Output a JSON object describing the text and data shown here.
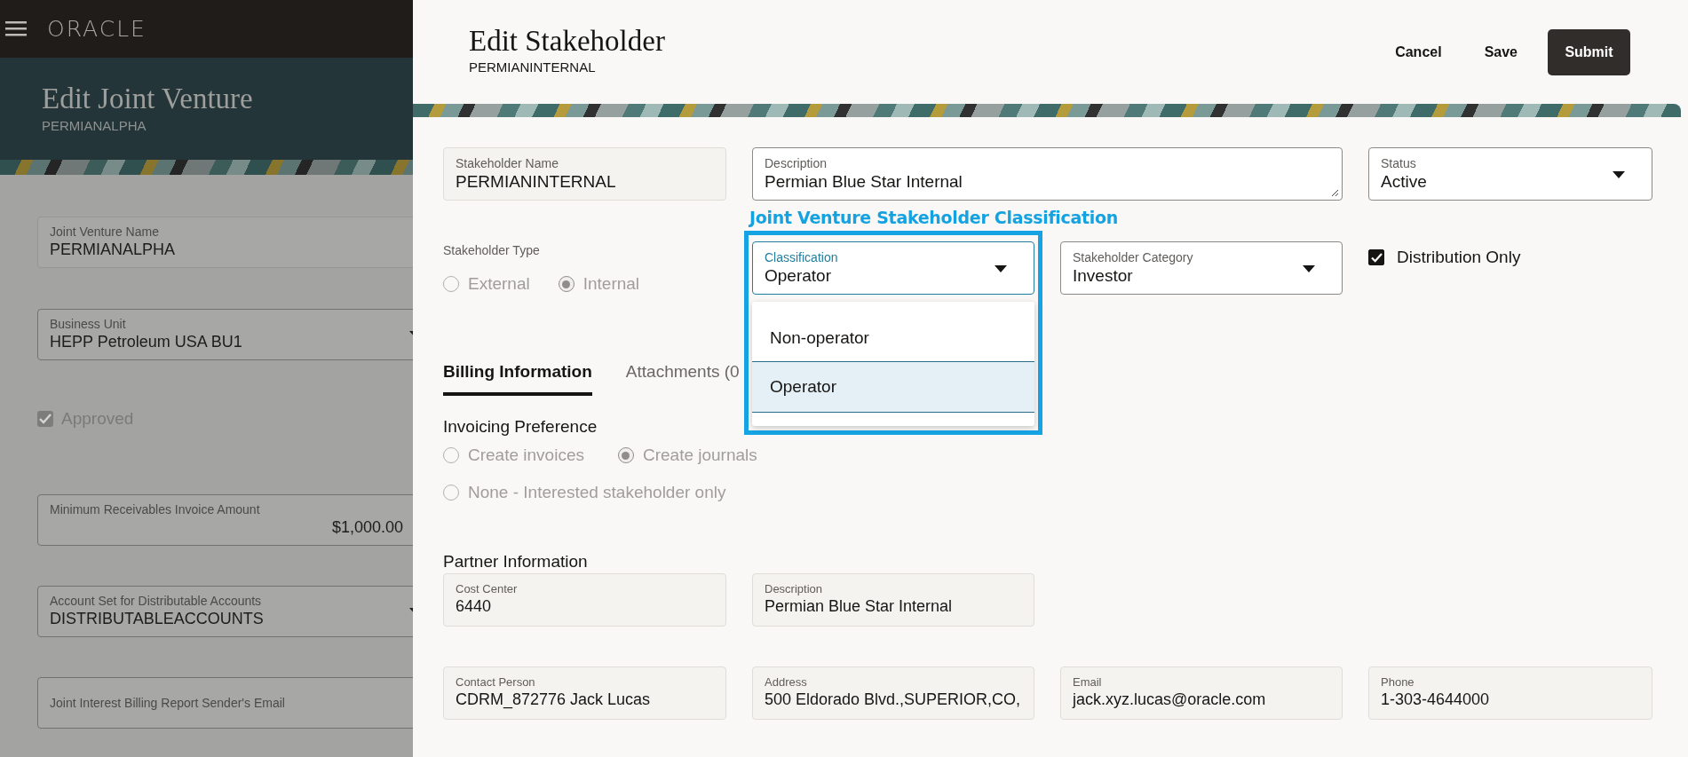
{
  "left_page": {
    "logo": "ORACLE",
    "title": "Edit Joint Venture",
    "subtitle": "PERMIANALPHA",
    "fields": [
      {
        "kind": "text",
        "label": "Joint Venture Name",
        "value": "PERMIANALPHA"
      },
      {
        "kind": "select",
        "label": "Business Unit",
        "value": "HEPP Petroleum USA BU1"
      },
      {
        "kind": "checkbox",
        "label": "Approved",
        "checked": true
      },
      {
        "kind": "amount",
        "label": "Minimum Receivables Invoice Amount",
        "value": "$1,000.00"
      },
      {
        "kind": "select",
        "label": "Account Set for Distributable Accounts",
        "value": "DISTRIBUTABLEACCOUNTS"
      },
      {
        "kind": "empty",
        "label": "Joint Interest Billing Report Sender's Email"
      }
    ]
  },
  "drawer": {
    "title": "Edit Stakeholder",
    "subtitle": "PERMIANINTERNAL",
    "buttons": [
      {
        "kind": "text",
        "label": "Cancel"
      },
      {
        "kind": "text",
        "label": "Save"
      },
      {
        "kind": "primary",
        "label": "Submit"
      }
    ],
    "stakeholder_name": {
      "label": "Stakeholder Name",
      "value": "PERMIANINTERNAL",
      "readonly": true
    },
    "description": {
      "label": "Description",
      "value": "Permian Blue Star Internal",
      "readonly": false
    },
    "status": {
      "label": "Status",
      "value": "Active"
    },
    "annotation": {
      "text": "Joint Venture Stakeholder Classification"
    },
    "stakeholder_type": {
      "label": "Stakeholder Type",
      "disabled": true,
      "options": [
        {
          "label": "External",
          "selected": false
        },
        {
          "label": "Internal",
          "selected": true
        }
      ]
    },
    "classification": {
      "label": "Classification",
      "value": "Operator",
      "focused": true,
      "expanded": true,
      "options": [
        {
          "label": "Non-operator",
          "selected": false
        },
        {
          "label": "Operator",
          "selected": true
        }
      ]
    },
    "stakeholder_category": {
      "label": "Stakeholder Category",
      "value": "Investor"
    },
    "distribution_only": {
      "label": "Distribution Only",
      "checked": true
    },
    "tabs": [
      {
        "label": "Billing Information",
        "selected": true
      },
      {
        "label": "Attachments (0",
        "selected": false
      }
    ],
    "invoicing_preference": {
      "label": "Invoicing Preference",
      "disabled": true,
      "options": [
        {
          "label": "Create invoices",
          "selected": false
        },
        {
          "label": "Create journals",
          "selected": true
        },
        {
          "label": "None - Interested stakeholder only",
          "selected": false
        }
      ]
    },
    "partner_information": {
      "title": "Partner Information",
      "rows": [
        [
          {
            "label": "Cost Center",
            "value": "6440"
          },
          {
            "label": "Description",
            "value": "Permian Blue Star Internal"
          }
        ],
        [
          {
            "label": "Contact Person",
            "value": "CDRM_872776 Jack Lucas"
          },
          {
            "label": "Address",
            "value": "500 Eldorado Blvd.,SUPERIOR,CO,"
          },
          {
            "label": "Email",
            "value": "jack.xyz.lucas@oracle.com"
          },
          {
            "label": "Phone",
            "value": "1-303-4644000"
          }
        ]
      ]
    }
  }
}
